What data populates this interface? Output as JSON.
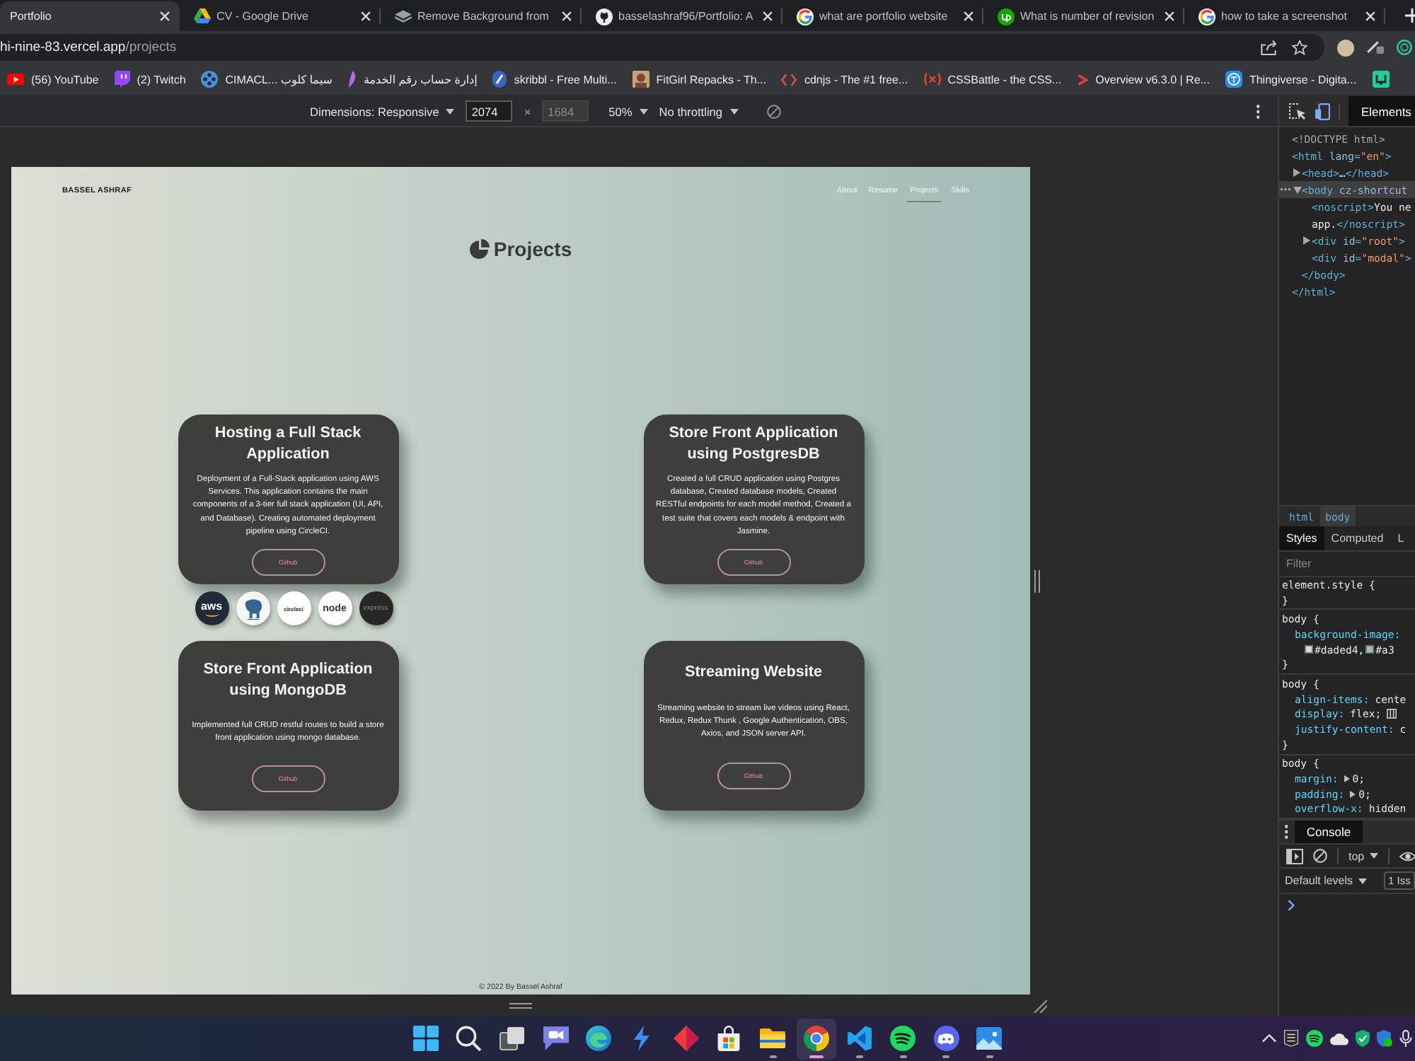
{
  "browser": {
    "tabs": [
      {
        "title": "Portfolio",
        "kind": "page",
        "selected": true
      },
      {
        "title": "CV - Google Drive",
        "kind": "drive",
        "selected": false
      },
      {
        "title": "Remove Background from",
        "kind": "layers",
        "selected": false
      },
      {
        "title": "basselashraf96/Portfolio: A",
        "kind": "cat",
        "selected": false
      },
      {
        "title": "what are portfolio website",
        "kind": "ring",
        "selected": false
      },
      {
        "title": "What is number of revision",
        "kind": "up",
        "selected": false
      },
      {
        "title": "how to take a screenshot",
        "kind": "ring",
        "selected": false
      }
    ],
    "address": {
      "host": "hi-nine-83.vercel.app",
      "path": "/projects"
    },
    "bookmarks": [
      {
        "label": "(56) YouTube",
        "kind": "play"
      },
      {
        "label": "(2) Twitch",
        "kind": "chat"
      },
      {
        "label": "CIMACL... سيما كلوب",
        "kind": "reel"
      },
      {
        "label": "إدارة حساب رقم الخدمة",
        "kind": "feather"
      },
      {
        "label": "skribbl - Free Multi...",
        "kind": "pencil"
      },
      {
        "label": "FitGirl Repacks - Th...",
        "kind": "picture"
      },
      {
        "label": "cdnjs - The #1 free...",
        "kind": "brackets"
      },
      {
        "label": "CSSBattle - the CSS...",
        "kind": "xmark"
      },
      {
        "label": "Overview v6.3.0 | Re...",
        "kind": "chevron"
      },
      {
        "label": "Thingiverse - Digita...",
        "kind": "tile"
      },
      {
        "kind": "square"
      }
    ]
  },
  "device_toolbar": {
    "dimensions": "Dimensions: Responsive",
    "width": {
      "value": "2074",
      "disabled": false
    },
    "separator": "×",
    "height": {
      "value": "1684",
      "disabled": true
    },
    "zoom": "50%",
    "throttling": "No throttling"
  },
  "page": {
    "brand": "BASSEL ASHRAF",
    "nav": [
      {
        "label": "About",
        "selected": false
      },
      {
        "label": "Resume",
        "selected": false
      },
      {
        "label": "Projects",
        "selected": true
      },
      {
        "label": "Skills",
        "selected": false
      }
    ],
    "heading": "Projects",
    "projects": [
      {
        "title": "Hosting a Full Stack Application",
        "description": "Deployment of a Full-Stack application using AWS Services. This application contains the main components of a 3-tier full stack application (UI, API, and Database). Creating automated deployment pipeline using CircleCI.",
        "button": "Github",
        "techs": [
          {
            "kind": "aws",
            "label": "aws"
          },
          {
            "kind": "elephant"
          },
          {
            "kind": "circleci",
            "label": "circleci"
          },
          {
            "kind": "node",
            "label": "node"
          },
          {
            "kind": "express",
            "label": "express"
          }
        ]
      },
      {
        "title": "Store Front Application using PostgresDB",
        "description": "Created a full CRUD application using Postgres database, Created database models, Created RESTful endpoints for each model method, Created a test suite that covers each models & endpoint with Jasmine.",
        "button": "Github"
      },
      {
        "title": "Store Front Application using MongoDB",
        "description": "Implemented full CRUD restful routes to build a store front application using mongo database.",
        "button": "Github"
      },
      {
        "title": "Streaming Website",
        "description": "Streaming website to stream live videos using React, Redux, Redux Thunk , Google Authentication, OBS, Axios, and JSON server API.",
        "button": "Github"
      }
    ],
    "footer": "© 2022 By Bassel Ashraf"
  },
  "devtools": {
    "tabs": [
      {
        "label": "Elements",
        "selected": true
      }
    ],
    "dom": [
      {
        "text": "<!DOCTYPE html>",
        "selected": false
      },
      {
        "text": "<html lang=\"en\">",
        "selected": false,
        "children": [
          {
            "text": "<head>…</head>",
            "expanded": false,
            "selected": false
          },
          {
            "text": "<body cz-shortcut",
            "expanded": true,
            "selected": true,
            "children": [
              {
                "lines": [
                  "<noscript>You ne",
                  "app.</noscript>"
                ],
                "selected": false
              },
              {
                "text": "<div id=\"root\">",
                "expanded": false,
                "selected": false
              },
              {
                "text": "<div id=\"modal\">",
                "selected": false
              }
            ],
            "close": "</body>"
          }
        ],
        "close": "</html>"
      }
    ],
    "breadcrumbs": [
      {
        "label": "html",
        "selected": false
      },
      {
        "label": "body",
        "selected": true
      }
    ],
    "styles_tabs": [
      {
        "label": "Styles",
        "selected": true
      },
      {
        "label": "Computed",
        "selected": false
      },
      {
        "label": "L",
        "selected": false
      }
    ],
    "filter": {
      "placeholder": "Filter"
    },
    "rules": [
      {
        "selector": "element.style {",
        "close": "}"
      },
      {
        "selector": "body {",
        "declarations": [
          {
            "kind": "swatches",
            "property": "background-image:",
            "swatches": [
              {
                "color": "#daded4",
                "text": "#daded4,"
              },
              {
                "color": "#a3bdb5",
                "text": "#a3"
              }
            ]
          }
        ],
        "close": "}"
      },
      {
        "selector": "body {",
        "declarations": [
          {
            "kind": "plain",
            "property": "align-items:",
            "value": "cente"
          },
          {
            "kind": "editor",
            "property": "display:",
            "value": "flex;"
          },
          {
            "kind": "plain",
            "property": "justify-content:",
            "value": "c"
          }
        ],
        "close": "}"
      },
      {
        "selector": "body {",
        "declarations": [
          {
            "kind": "shorthand",
            "property": "margin:",
            "value": "0;",
            "expanded": false
          },
          {
            "kind": "shorthand",
            "property": "padding:",
            "value": "0;",
            "expanded": false
          },
          {
            "kind": "plain",
            "property": "overflow-x:",
            "value": "hidden"
          }
        ]
      }
    ],
    "drawer": {
      "tabs": [
        {
          "label": "Console",
          "selected": true
        }
      ],
      "context": "top",
      "levels": "Default levels",
      "issues": "1 Iss"
    }
  },
  "taskbar": {
    "apps": [
      {
        "kind": "start",
        "running": false,
        "selected": false
      },
      {
        "kind": "search",
        "running": false,
        "selected": false
      },
      {
        "kind": "taskview",
        "running": false,
        "selected": false
      },
      {
        "kind": "chat",
        "running": false,
        "selected": false
      },
      {
        "kind": "edge",
        "running": false,
        "selected": false
      },
      {
        "kind": "bolt",
        "running": false,
        "selected": false
      },
      {
        "kind": "diamond",
        "running": false,
        "selected": false
      },
      {
        "kind": "store",
        "running": false,
        "selected": false
      },
      {
        "kind": "folder",
        "running": true,
        "selected": false
      },
      {
        "kind": "chrome",
        "running": true,
        "selected": true
      },
      {
        "kind": "vscode",
        "running": true,
        "selected": false
      },
      {
        "kind": "spotify",
        "running": true,
        "selected": false
      },
      {
        "kind": "discord",
        "running": true,
        "selected": false
      },
      {
        "kind": "photos",
        "running": true,
        "selected": false
      }
    ]
  }
}
